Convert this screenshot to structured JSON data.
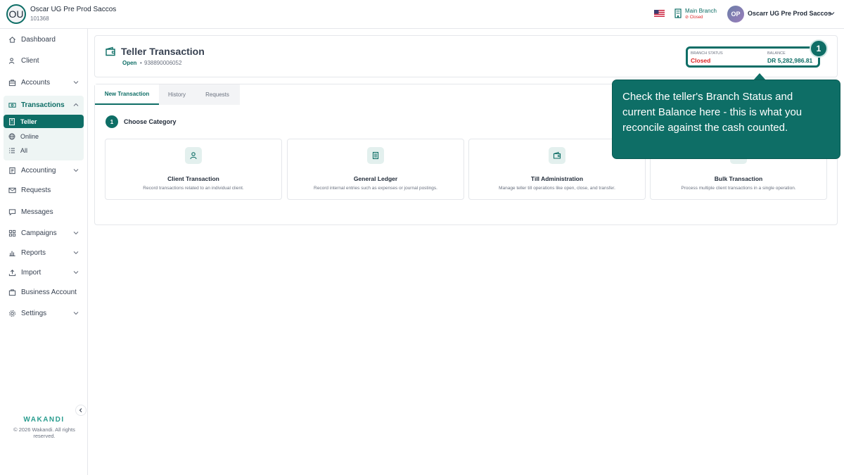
{
  "topbar": {
    "org_initials": "OU",
    "org_name": "Oscar UG Pre Prod Saccos",
    "org_id": "101368",
    "branch_name": "Main Branch",
    "branch_status": "Closed",
    "user_initials": "OP",
    "user_name": "Oscarr UG Pre Prod Saccos"
  },
  "sidebar": {
    "items": [
      {
        "label": "Dashboard",
        "icon": "home-icon"
      },
      {
        "label": "Client",
        "icon": "users-icon"
      },
      {
        "label": "Accounts",
        "icon": "briefcase-icon"
      },
      {
        "label": "Transactions",
        "icon": "cash-icon"
      },
      {
        "label": "Accounting",
        "icon": "ledger-icon"
      },
      {
        "label": "Requests",
        "icon": "mail-icon"
      },
      {
        "label": "Messages",
        "icon": "message-icon"
      },
      {
        "label": "Campaigns",
        "icon": "grid-icon"
      },
      {
        "label": "Reports",
        "icon": "bar-chart-icon"
      },
      {
        "label": "Import",
        "icon": "upload-icon"
      },
      {
        "label": "Business Account",
        "icon": "building-icon"
      },
      {
        "label": "Settings",
        "icon": "gear-icon"
      }
    ],
    "sub_items": [
      {
        "label": "Teller",
        "icon": "calculator-icon",
        "active": true
      },
      {
        "label": "Online",
        "icon": "globe-icon"
      },
      {
        "label": "All",
        "icon": "list-icon"
      }
    ],
    "brand": "WAKANDI",
    "copyright": "© 2026 Wakandi. All rights reserved."
  },
  "header": {
    "title": "Teller Transaction",
    "status": "Open",
    "separator": "•",
    "teller_id": "938890006052",
    "branch_status_label": "BRANCH STATUS",
    "branch_status_value": "Closed",
    "balance_label": "BALANCE",
    "balance_value": "DR 5,282,986.81"
  },
  "tabs": [
    "New Transaction",
    "History",
    "Requests"
  ],
  "step": {
    "number": "1",
    "title": "Choose Category"
  },
  "categories": [
    {
      "title": "Client Transaction",
      "desc": "Record transactions related to an individual client.",
      "icon": "user-icon"
    },
    {
      "title": "General Ledger",
      "desc": "Record internal entries such as expenses or journal postings.",
      "icon": "document-icon"
    },
    {
      "title": "Till Administration",
      "desc": "Manage teller till operations like open, close, and transfer.",
      "icon": "wallet-icon"
    },
    {
      "title": "Bulk Transaction",
      "desc": "Process multiple client transactions in a single operation.",
      "icon": "stack-icon"
    }
  ],
  "tour": {
    "step_badge": "1",
    "text": "Check the teller's Branch Status and current Balance here - this is what you reconcile against the cash counted."
  },
  "colors": {
    "accent": "#0e6e66",
    "danger": "#dc2626"
  }
}
